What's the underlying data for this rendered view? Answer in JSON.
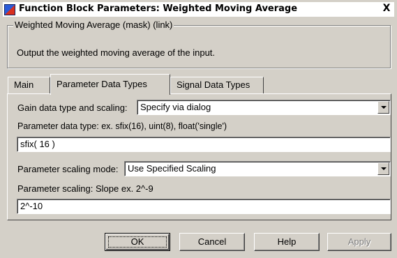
{
  "window": {
    "title": "Function Block Parameters: Weighted Moving Average",
    "close_label": "X"
  },
  "group": {
    "legend": "Weighted Moving Average (mask) (link)",
    "description": "Output the weighted moving average of the input."
  },
  "tabs": [
    {
      "label": "Main"
    },
    {
      "label": "Parameter Data Types"
    },
    {
      "label": "Signal Data Types"
    }
  ],
  "active_tab_index": 1,
  "params": {
    "gain_label": "Gain data type and scaling:",
    "gain_value": "Specify via dialog",
    "param_dtype_label": "Parameter data type:    ex. sfix(16),  uint(8), float('single')",
    "param_dtype_value": "sfix( 16 )",
    "scaling_mode_label": "Parameter scaling mode:",
    "scaling_mode_value": "Use Specified Scaling",
    "scaling_label": "Parameter scaling:   Slope   ex.  2^-9",
    "scaling_value": "2^-10"
  },
  "buttons": {
    "ok": "OK",
    "cancel": "Cancel",
    "help": "Help",
    "apply": "Apply"
  }
}
